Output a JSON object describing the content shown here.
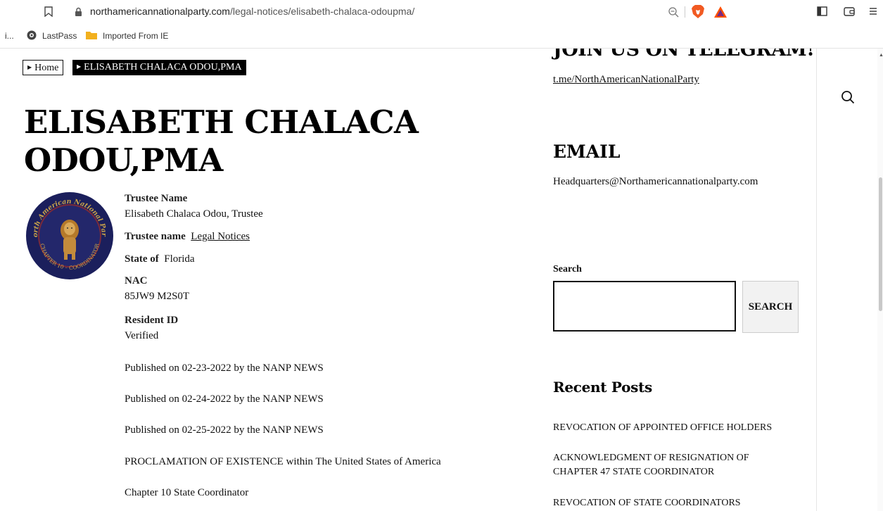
{
  "browser": {
    "url_domain": "northamericannationalparty.com",
    "url_path": "/legal-notices/elisabeth-chalaca-odoupma/",
    "bookmarks": {
      "ellipsis": "i...",
      "lastpass": "LastPass",
      "imported": "Imported From IE"
    },
    "icons": [
      "bookmark-icon",
      "lock-icon",
      "zoom-icon",
      "brave-icon",
      "bat-icon",
      "sidebar-toggle-icon",
      "wallet-icon",
      "menu-icon",
      "lastpass-icon",
      "folder-icon"
    ]
  },
  "breadcrumb": {
    "home": "Home",
    "current": "ELISABETH CHALACA ODOU,PMA"
  },
  "title_lines": [
    "ELISABETH CHALACA",
    "ODOU,PMA"
  ],
  "logo": {
    "top_text": "North American National Party",
    "bottom_text": "CHAPTER 10 – COORDINATOR",
    "colors": {
      "ring": "#1b1f5c",
      "accent": "#7a2a3a",
      "gold": "#c9a24a"
    }
  },
  "details": {
    "trustee_name_label": "Trustee Name",
    "trustee_name_value": "Elisabeth Chalaca Odou, Trustee",
    "trustee_name2_label": "Trustee name",
    "trustee_name2_link": "Legal Notices",
    "state_label": "State of",
    "state_value": "Florida",
    "nac_label": "NAC",
    "nac_value": "85JW9 M2S0T",
    "resident_label": "Resident ID",
    "resident_value": "Verified",
    "published": [
      "Published on 02-23-2022 by the NANP NEWS",
      "Published on 02-24-2022 by the NANP NEWS",
      "Published on 02-25-2022 by the NANP NEWS"
    ],
    "proclamation": "PROCLAMATION OF EXISTENCE within The United States of America",
    "chapter": "Chapter 10 State Coordinator"
  },
  "sidebar": {
    "join_title": "JOIN US ON TELEGRAM!",
    "telegram_link": "t.me/NorthAmericanNationalParty",
    "email_title": "EMAIL",
    "email_value": "Headquarters@Northamericannationalparty.com",
    "search_label": "Search",
    "search_value": "",
    "search_button": "SEARCH",
    "recent_title": "Recent Posts",
    "recent_posts": [
      "REVOCATION OF APPOINTED OFFICE HOLDERS",
      "ACKNOWLEDGMENT OF RESIGNATION OF CHAPTER 47 STATE COORDINATOR",
      "REVOCATION OF STATE COORDINATORS"
    ]
  }
}
